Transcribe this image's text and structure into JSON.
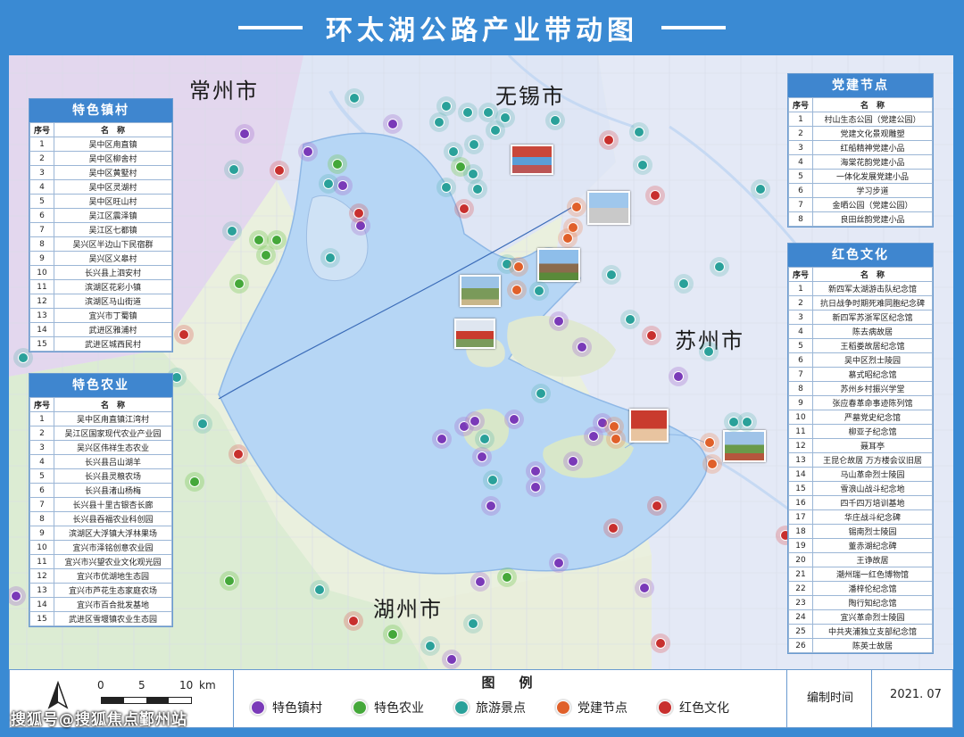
{
  "title": "环太湖公路产业带动图",
  "cities": {
    "changzhou": "常州市",
    "wuxi": "无锡市",
    "suzhou": "苏州市",
    "huzhou": "湖州市"
  },
  "colors": {
    "village": "#7a3ab8",
    "agriculture": "#45a83a",
    "scenic": "#2aa19a",
    "party": "#e0602a",
    "red_culture": "#c8302e"
  },
  "table_villages": {
    "title": "特色镇村",
    "col_no": "序号",
    "col_name": "名　称",
    "rows": [
      [
        "1",
        "吴中区甪直镇"
      ],
      [
        "2",
        "吴中区柳舍村"
      ],
      [
        "3",
        "吴中区黄墅村"
      ],
      [
        "4",
        "吴中区灵湖村"
      ],
      [
        "5",
        "吴中区旺山村"
      ],
      [
        "6",
        "吴江区震泽镇"
      ],
      [
        "7",
        "吴江区七都镇"
      ],
      [
        "8",
        "吴兴区半边山下民宿群"
      ],
      [
        "9",
        "吴兴区义皋村"
      ],
      [
        "10",
        "长兴县上泗安村"
      ],
      [
        "11",
        "滨湖区花彩小镇"
      ],
      [
        "12",
        "滨湖区马山街道"
      ],
      [
        "13",
        "宜兴市丁蜀镇"
      ],
      [
        "14",
        "武进区雅浦村"
      ],
      [
        "15",
        "武进区城西民村"
      ]
    ]
  },
  "table_agri": {
    "title": "特色农业",
    "col_no": "序号",
    "col_name": "名　称",
    "rows": [
      [
        "1",
        "吴中区甪直镇江湾村"
      ],
      [
        "2",
        "吴江区国家现代农业产业园"
      ],
      [
        "3",
        "吴兴区伟祥生态农业"
      ],
      [
        "4",
        "长兴县吕山湖羊"
      ],
      [
        "5",
        "长兴县灵粮农场"
      ],
      [
        "6",
        "长兴县渚山杨梅"
      ],
      [
        "7",
        "长兴县十里古银杏长廊"
      ],
      [
        "8",
        "长兴县吞福农业科创园"
      ],
      [
        "9",
        "滨湖区大浮镇大浮林果场"
      ],
      [
        "10",
        "宜兴市泽铭创意农业园"
      ],
      [
        "11",
        "宜兴市兴望农业文化观光园"
      ],
      [
        "12",
        "宜兴市优湖地生态园"
      ],
      [
        "13",
        "宜兴市芦花生态家庭农场"
      ],
      [
        "14",
        "宜兴市百合批发基地"
      ],
      [
        "15",
        "武进区雪堰镇农业生态园"
      ]
    ]
  },
  "table_party": {
    "title": "党建节点",
    "col_no": "序号",
    "col_name": "名　称",
    "rows": [
      [
        "1",
        "村山生态公园（党建公园）"
      ],
      [
        "2",
        "党建文化景观雕塑"
      ],
      [
        "3",
        "红船精神党建小品"
      ],
      [
        "4",
        "海棠花韵党建小品"
      ],
      [
        "5",
        "一体化发展党建小品"
      ],
      [
        "6",
        "学习步道"
      ],
      [
        "7",
        "金晒公园（党建公园）"
      ],
      [
        "8",
        "良田丝韵党建小品"
      ]
    ]
  },
  "table_red": {
    "title": "红色文化",
    "col_no": "序号",
    "col_name": "名　称",
    "rows": [
      [
        "1",
        "新四军太湖游击队纪念馆"
      ],
      [
        "2",
        "抗日战争时期死难同胞纪念碑"
      ],
      [
        "3",
        "新四军苏浙军区纪念馆"
      ],
      [
        "4",
        "陈去病故居"
      ],
      [
        "5",
        "王稻娄故居纪念馆"
      ],
      [
        "6",
        "吴中区烈士陵园"
      ],
      [
        "7",
        "慕式昭纪念馆"
      ],
      [
        "8",
        "苏州乡村振兴学堂"
      ],
      [
        "9",
        "张应春革命事迹陈列馆"
      ],
      [
        "10",
        "严墓党史纪念馆"
      ],
      [
        "11",
        "柳亚子纪念馆"
      ],
      [
        "12",
        "聂耳亭"
      ],
      [
        "13",
        "王昆仑故居 万方楼会议旧居"
      ],
      [
        "14",
        "马山革命烈士陵园"
      ],
      [
        "15",
        "雪浪山战斗纪念地"
      ],
      [
        "16",
        "四千四万培训基地"
      ],
      [
        "17",
        "华庄战斗纪念碑"
      ],
      [
        "18",
        "锡南烈士陵园"
      ],
      [
        "19",
        "董赤湖纪念碑"
      ],
      [
        "20",
        "王诤故居"
      ],
      [
        "21",
        "潮州瑞一红色博物馆"
      ],
      [
        "22",
        "潘梓伦纪念馆"
      ],
      [
        "23",
        "陶行知纪念馆"
      ],
      [
        "24",
        "宜兴革命烈士陵园"
      ],
      [
        "25",
        "中共夹浦独立支部纪念馆"
      ],
      [
        "26",
        "陈英士故居"
      ]
    ]
  },
  "legend": {
    "title": "图　例",
    "items": [
      {
        "label": "特色镇村",
        "color": "#7a3ab8"
      },
      {
        "label": "特色农业",
        "color": "#45a83a"
      },
      {
        "label": "旅游景点",
        "color": "#2aa19a"
      },
      {
        "label": "党建节点",
        "color": "#e0602a"
      },
      {
        "label": "红色文化",
        "color": "#c8302e"
      }
    ]
  },
  "scale": {
    "t0": "0",
    "t5": "5",
    "t10": "10",
    "unit": "km"
  },
  "compile": {
    "label": "编制时间",
    "value": "2021. 07"
  },
  "watermark": "搜狐号@搜狐焦点鄞州站"
}
